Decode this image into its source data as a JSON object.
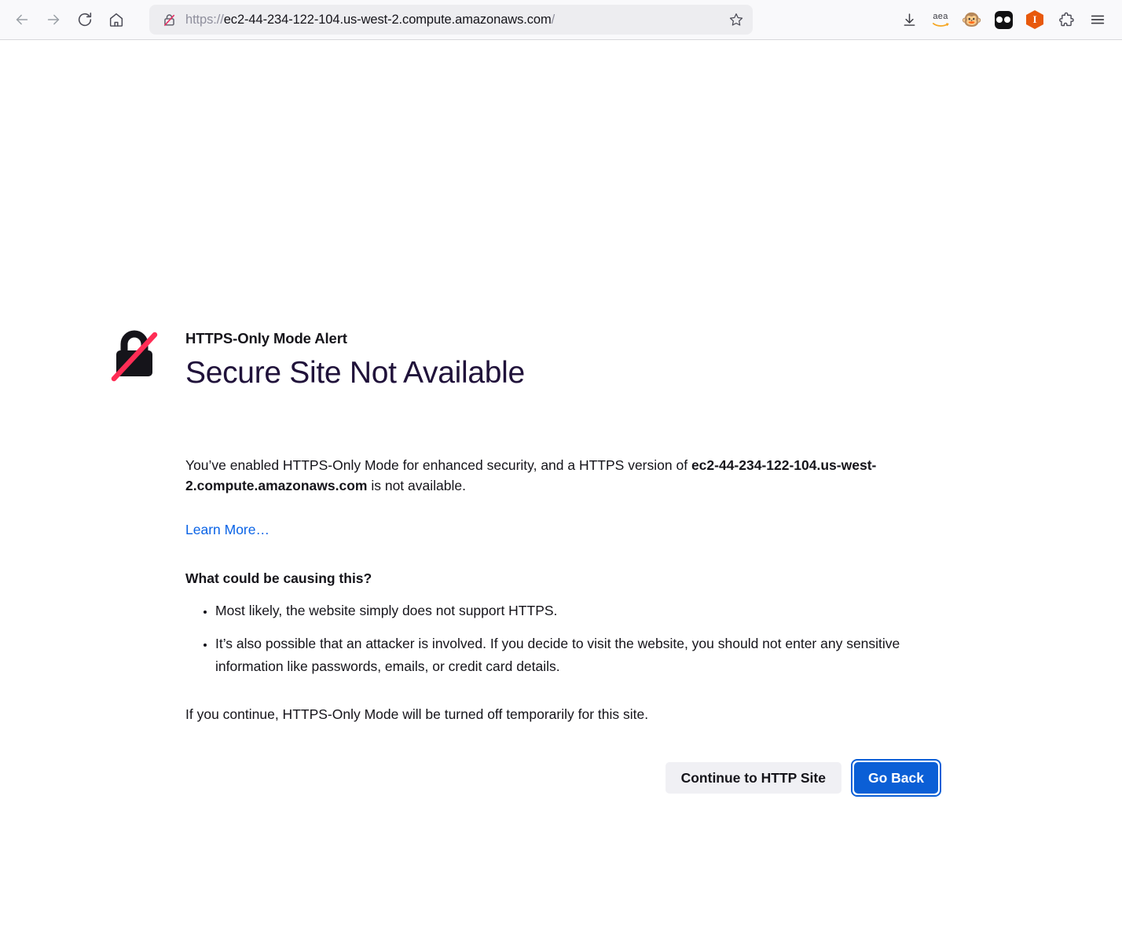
{
  "browser": {
    "nav": {
      "back_label": "Back",
      "forward_label": "Forward",
      "reload_label": "Reload",
      "home_label": "Home"
    },
    "urlbar": {
      "scheme": "https://",
      "host": "ec2-44-234-122-104.us-west-2.compute.amazonaws.com",
      "path": "/",
      "identity_icon": "lock-slash-icon",
      "bookmark_icon": "star-icon",
      "background": "#ededf0"
    },
    "toolbar_icons": [
      {
        "name": "downloads-icon",
        "label": "Downloads"
      },
      {
        "name": "aea-extension-icon",
        "label": "aea"
      },
      {
        "name": "monkey-extension-icon",
        "label": "🐵"
      },
      {
        "name": "dark-reader-extension-icon",
        "label": "Dark Reader"
      },
      {
        "name": "orange-hexagon-extension-icon",
        "label": "I"
      },
      {
        "name": "extensions-puzzle-icon",
        "label": "Extensions"
      },
      {
        "name": "app-menu-icon",
        "label": "Open application menu"
      }
    ]
  },
  "error_page": {
    "icon": "lock-slash-icon",
    "eyebrow": "HTTPS-Only Mode Alert",
    "title": "Secure Site Not Available",
    "intro_before": "You’ve enabled HTTPS-Only Mode for enhanced security, and a HTTPS version of ",
    "intro_host": "ec2-44-234-122-104.us-west-2.compute.amazonaws.com",
    "intro_after": " is not available.",
    "learn_more": "Learn More…",
    "causes_heading": "What could be causing this?",
    "causes": [
      "Most likely, the website simply does not support HTTPS.",
      "It’s also possible that an attacker is involved. If you decide to visit the website, you should not enter any sensitive information like passwords, emails, or credit card details."
    ],
    "continue_note": "If you continue, HTTPS-Only Mode will be turned off temporarily for this site.",
    "buttons": {
      "continue_label": "Continue to HTTP Site",
      "go_back_label": "Go Back"
    },
    "colors": {
      "link": "#0a63e6",
      "primary_button": "#0b5fd6",
      "secondary_button": "#f0f0f4",
      "slash": "#ff2d55"
    }
  }
}
